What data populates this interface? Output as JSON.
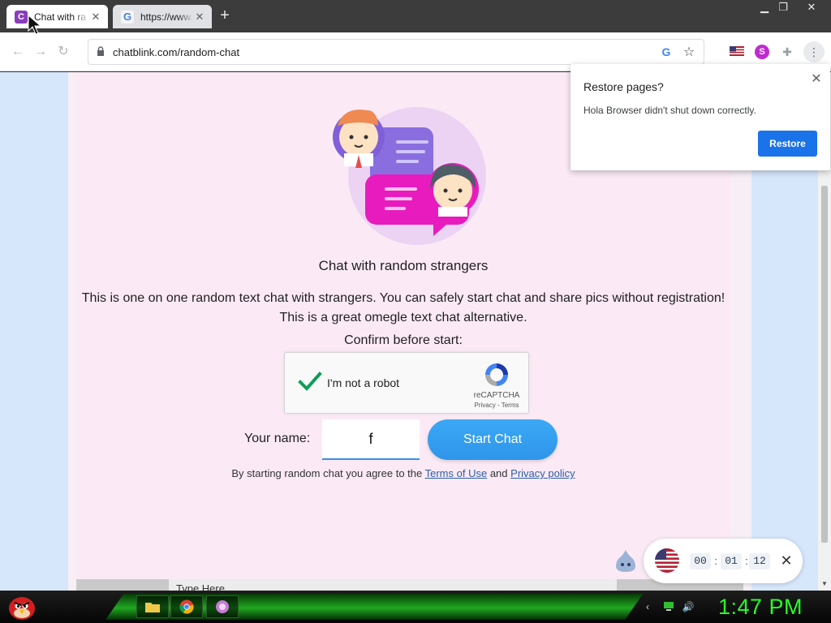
{
  "browser": {
    "tabs": [
      {
        "title": "Chat with ra",
        "favicon": "chatblink-favicon-icon",
        "active": true
      },
      {
        "title": "https://www.",
        "favicon": "google-favicon-icon",
        "active": false
      }
    ],
    "new_tab": "+",
    "window_controls": {
      "minimize": "▁",
      "maximize": "❐",
      "close": "✕"
    },
    "url": "chatblink.com/random-chat",
    "extensions": [
      "us-flag-icon",
      "s-extension-icon",
      "puzzle-icon",
      "menu-dots-icon"
    ]
  },
  "page": {
    "heading": "Chat with random strangers",
    "description_line1": "This is one on one random text chat with strangers. You can safely start chat and share pics without registration!",
    "description_line2": "This is a great omegle text chat alternative.",
    "confirm_label": "Confirm before start:",
    "recaptcha": {
      "label": "I'm not a robot",
      "brand": "reCAPTCHA",
      "links": "Privacy - Terms",
      "checked": true
    },
    "name_label": "Your name:",
    "name_value": "f",
    "start_button": "Start Chat",
    "terms_prefix": "By starting random chat you agree to the",
    "terms_link": "Terms of Use",
    "terms_and": "and",
    "privacy_link": "Privacy policy",
    "bottom_input_placeholder": "Type Here"
  },
  "restore_popup": {
    "title": "Restore pages?",
    "message": "Hola Browser didn't shut down correctly.",
    "button": "Restore",
    "close": "✕"
  },
  "timer_widget": {
    "hours": "00",
    "minutes": "01",
    "seconds": "12",
    "separator": ":",
    "close": "✕"
  },
  "taskbar": {
    "clock": "1:47 PM"
  },
  "colors": {
    "accent_blue": "#1a73e8",
    "start_button": "#2f95ea",
    "page_bg": "#fbeaf6",
    "clock_green": "#27ff27"
  }
}
